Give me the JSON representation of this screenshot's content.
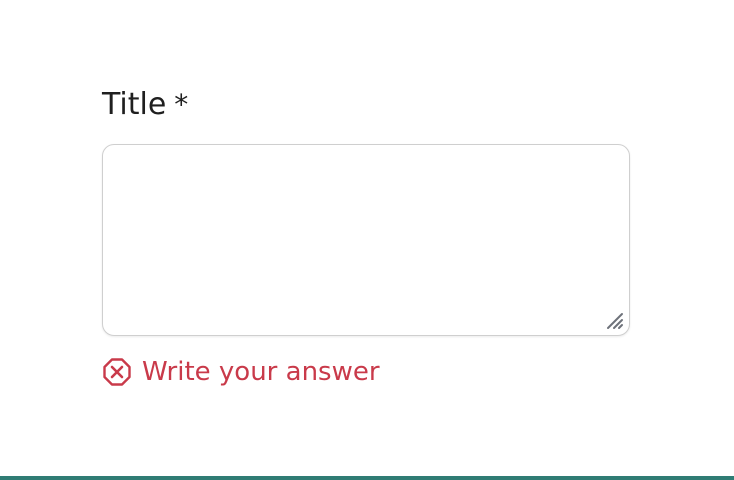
{
  "field": {
    "label": "Title",
    "required_mark": "*",
    "value": "",
    "placeholder": "",
    "error_message": "Write your answer"
  },
  "icons": {
    "error": "error-octagon-x-icon",
    "resize": "resize-handle-icon"
  },
  "colors": {
    "error": "#c93a4a",
    "text": "#1f1f1f",
    "border": "#cfcfcf",
    "bottom_bar": "#2f7c74"
  }
}
